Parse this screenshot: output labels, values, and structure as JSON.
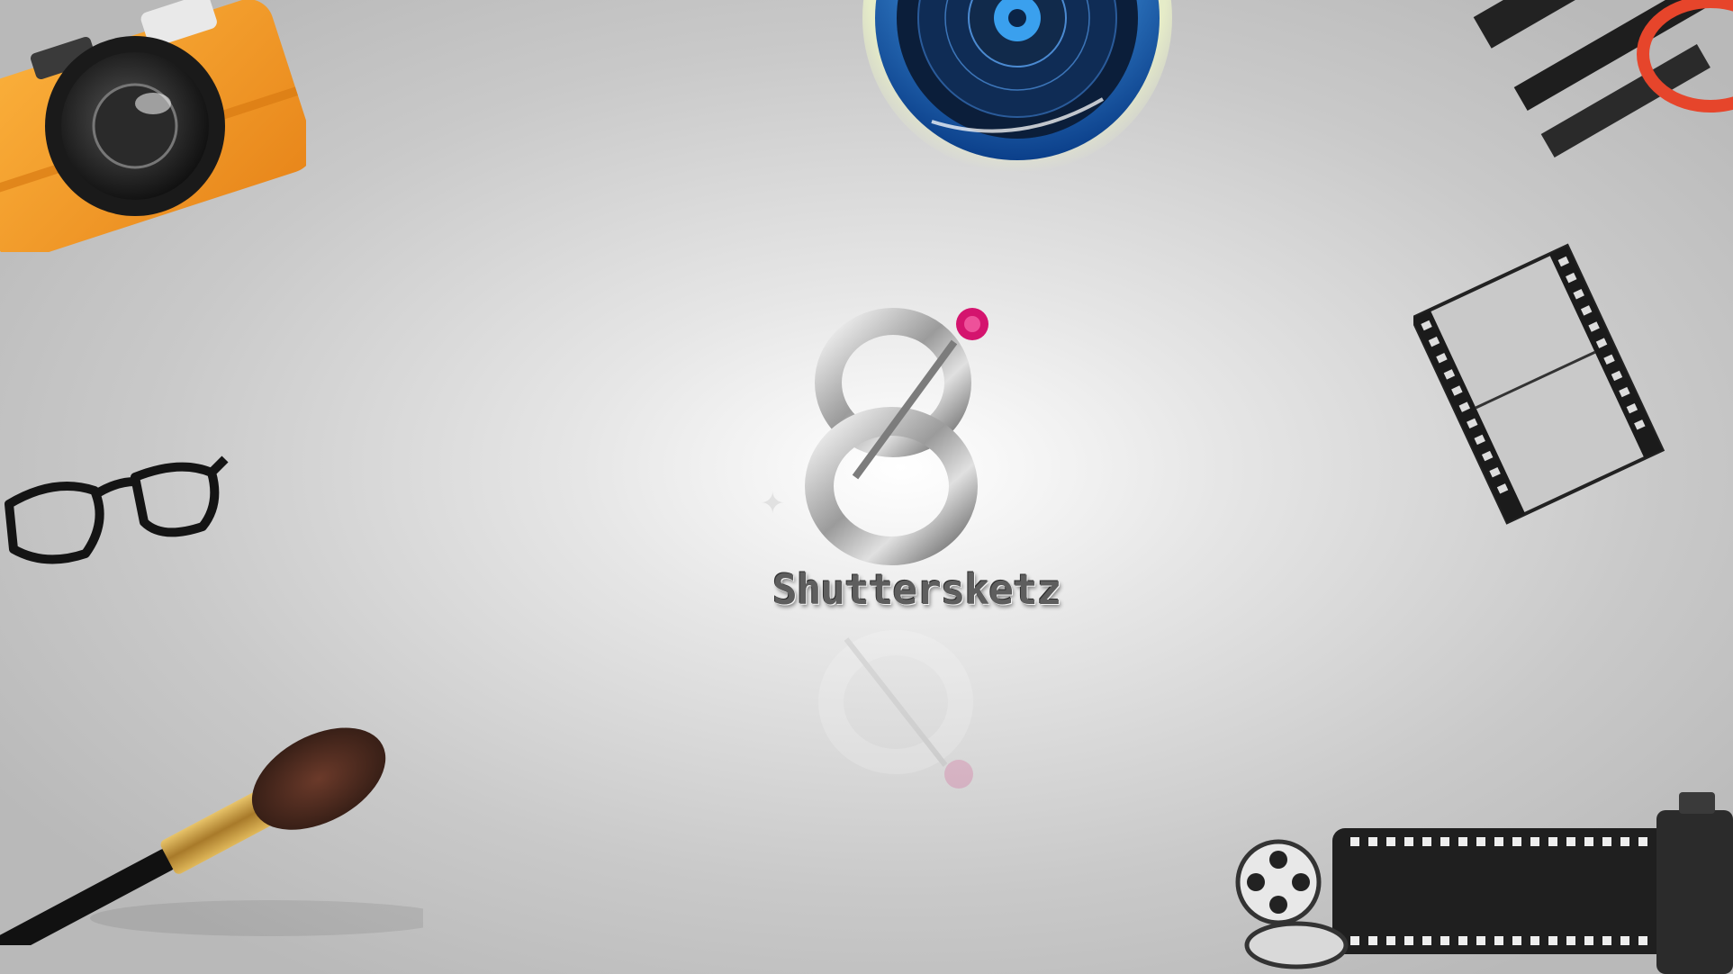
{
  "brand": {
    "name": "Shuttersketz"
  },
  "colors": {
    "camera_body": "#f29a1f",
    "lens_ring": "#1a6fd1",
    "logo_accent": "#d4146e",
    "film": "#1f1f1f",
    "brush_ferrule": "#c9a04a"
  }
}
